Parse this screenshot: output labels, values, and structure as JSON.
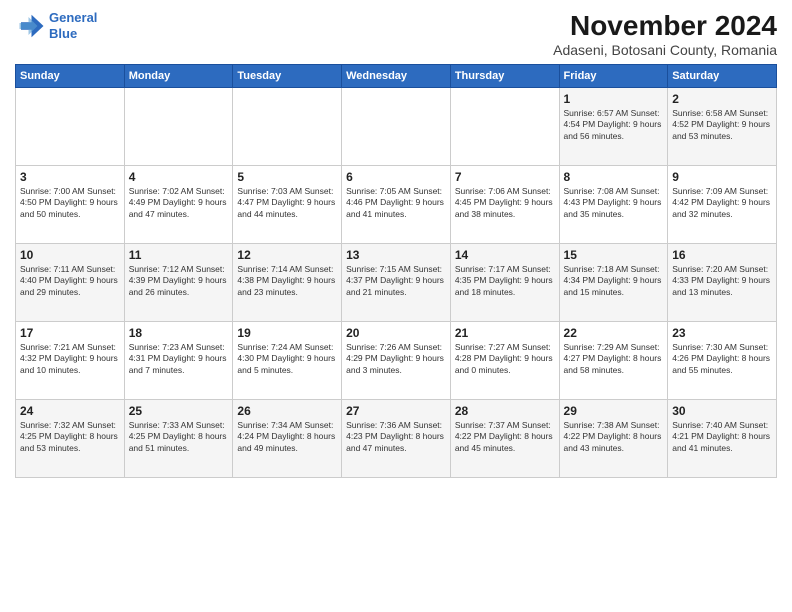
{
  "header": {
    "logo_line1": "General",
    "logo_line2": "Blue",
    "main_title": "November 2024",
    "subtitle": "Adaseni, Botosani County, Romania"
  },
  "days_of_week": [
    "Sunday",
    "Monday",
    "Tuesday",
    "Wednesday",
    "Thursday",
    "Friday",
    "Saturday"
  ],
  "weeks": [
    [
      {
        "day": "",
        "info": ""
      },
      {
        "day": "",
        "info": ""
      },
      {
        "day": "",
        "info": ""
      },
      {
        "day": "",
        "info": ""
      },
      {
        "day": "",
        "info": ""
      },
      {
        "day": "1",
        "info": "Sunrise: 6:57 AM\nSunset: 4:54 PM\nDaylight: 9 hours and 56 minutes."
      },
      {
        "day": "2",
        "info": "Sunrise: 6:58 AM\nSunset: 4:52 PM\nDaylight: 9 hours and 53 minutes."
      }
    ],
    [
      {
        "day": "3",
        "info": "Sunrise: 7:00 AM\nSunset: 4:50 PM\nDaylight: 9 hours and 50 minutes."
      },
      {
        "day": "4",
        "info": "Sunrise: 7:02 AM\nSunset: 4:49 PM\nDaylight: 9 hours and 47 minutes."
      },
      {
        "day": "5",
        "info": "Sunrise: 7:03 AM\nSunset: 4:47 PM\nDaylight: 9 hours and 44 minutes."
      },
      {
        "day": "6",
        "info": "Sunrise: 7:05 AM\nSunset: 4:46 PM\nDaylight: 9 hours and 41 minutes."
      },
      {
        "day": "7",
        "info": "Sunrise: 7:06 AM\nSunset: 4:45 PM\nDaylight: 9 hours and 38 minutes."
      },
      {
        "day": "8",
        "info": "Sunrise: 7:08 AM\nSunset: 4:43 PM\nDaylight: 9 hours and 35 minutes."
      },
      {
        "day": "9",
        "info": "Sunrise: 7:09 AM\nSunset: 4:42 PM\nDaylight: 9 hours and 32 minutes."
      }
    ],
    [
      {
        "day": "10",
        "info": "Sunrise: 7:11 AM\nSunset: 4:40 PM\nDaylight: 9 hours and 29 minutes."
      },
      {
        "day": "11",
        "info": "Sunrise: 7:12 AM\nSunset: 4:39 PM\nDaylight: 9 hours and 26 minutes."
      },
      {
        "day": "12",
        "info": "Sunrise: 7:14 AM\nSunset: 4:38 PM\nDaylight: 9 hours and 23 minutes."
      },
      {
        "day": "13",
        "info": "Sunrise: 7:15 AM\nSunset: 4:37 PM\nDaylight: 9 hours and 21 minutes."
      },
      {
        "day": "14",
        "info": "Sunrise: 7:17 AM\nSunset: 4:35 PM\nDaylight: 9 hours and 18 minutes."
      },
      {
        "day": "15",
        "info": "Sunrise: 7:18 AM\nSunset: 4:34 PM\nDaylight: 9 hours and 15 minutes."
      },
      {
        "day": "16",
        "info": "Sunrise: 7:20 AM\nSunset: 4:33 PM\nDaylight: 9 hours and 13 minutes."
      }
    ],
    [
      {
        "day": "17",
        "info": "Sunrise: 7:21 AM\nSunset: 4:32 PM\nDaylight: 9 hours and 10 minutes."
      },
      {
        "day": "18",
        "info": "Sunrise: 7:23 AM\nSunset: 4:31 PM\nDaylight: 9 hours and 7 minutes."
      },
      {
        "day": "19",
        "info": "Sunrise: 7:24 AM\nSunset: 4:30 PM\nDaylight: 9 hours and 5 minutes."
      },
      {
        "day": "20",
        "info": "Sunrise: 7:26 AM\nSunset: 4:29 PM\nDaylight: 9 hours and 3 minutes."
      },
      {
        "day": "21",
        "info": "Sunrise: 7:27 AM\nSunset: 4:28 PM\nDaylight: 9 hours and 0 minutes."
      },
      {
        "day": "22",
        "info": "Sunrise: 7:29 AM\nSunset: 4:27 PM\nDaylight: 8 hours and 58 minutes."
      },
      {
        "day": "23",
        "info": "Sunrise: 7:30 AM\nSunset: 4:26 PM\nDaylight: 8 hours and 55 minutes."
      }
    ],
    [
      {
        "day": "24",
        "info": "Sunrise: 7:32 AM\nSunset: 4:25 PM\nDaylight: 8 hours and 53 minutes."
      },
      {
        "day": "25",
        "info": "Sunrise: 7:33 AM\nSunset: 4:25 PM\nDaylight: 8 hours and 51 minutes."
      },
      {
        "day": "26",
        "info": "Sunrise: 7:34 AM\nSunset: 4:24 PM\nDaylight: 8 hours and 49 minutes."
      },
      {
        "day": "27",
        "info": "Sunrise: 7:36 AM\nSunset: 4:23 PM\nDaylight: 8 hours and 47 minutes."
      },
      {
        "day": "28",
        "info": "Sunrise: 7:37 AM\nSunset: 4:22 PM\nDaylight: 8 hours and 45 minutes."
      },
      {
        "day": "29",
        "info": "Sunrise: 7:38 AM\nSunset: 4:22 PM\nDaylight: 8 hours and 43 minutes."
      },
      {
        "day": "30",
        "info": "Sunrise: 7:40 AM\nSunset: 4:21 PM\nDaylight: 8 hours and 41 minutes."
      }
    ]
  ]
}
